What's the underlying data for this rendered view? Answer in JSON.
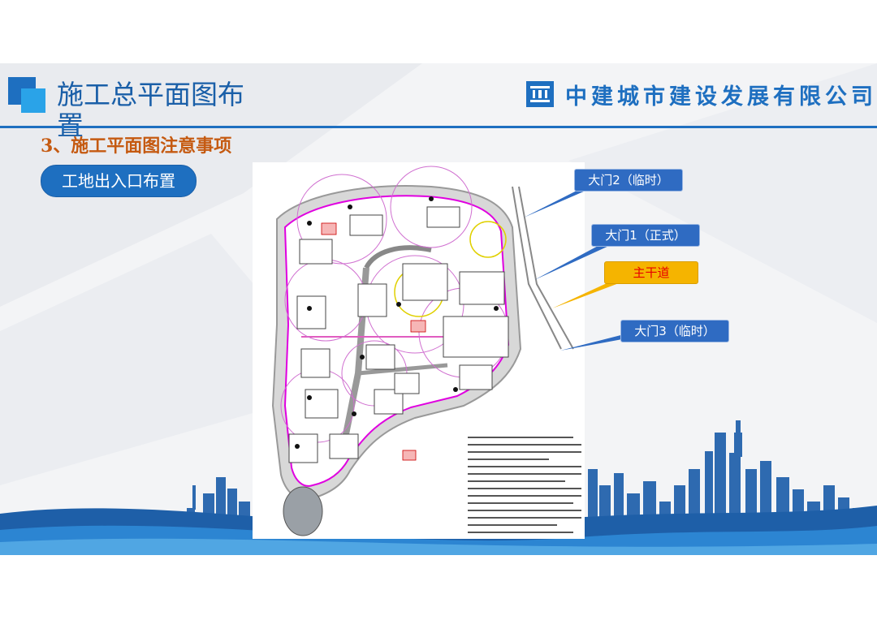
{
  "header": {
    "title": "施工总平面图布置",
    "company_name": "中建城市建设发展有限公司",
    "company_logo_icon": "cscec-logo-icon"
  },
  "section": {
    "subtitle": "3、施工平面图注意事项",
    "pill_label": "工地出入口布置"
  },
  "callouts": {
    "gate2": "大门2（临时）",
    "gate1": "大门1（正式）",
    "main_road": "主干道",
    "gate3": "大门3（临时）"
  },
  "colors": {
    "brand_blue": "#1e6fc0",
    "light_blue": "#2aa3e8",
    "subtitle_orange": "#c55a11",
    "callout_blue": "#2f6bc2",
    "callout_yellow": "#f5b400",
    "callout_red_text": "#e60000"
  }
}
